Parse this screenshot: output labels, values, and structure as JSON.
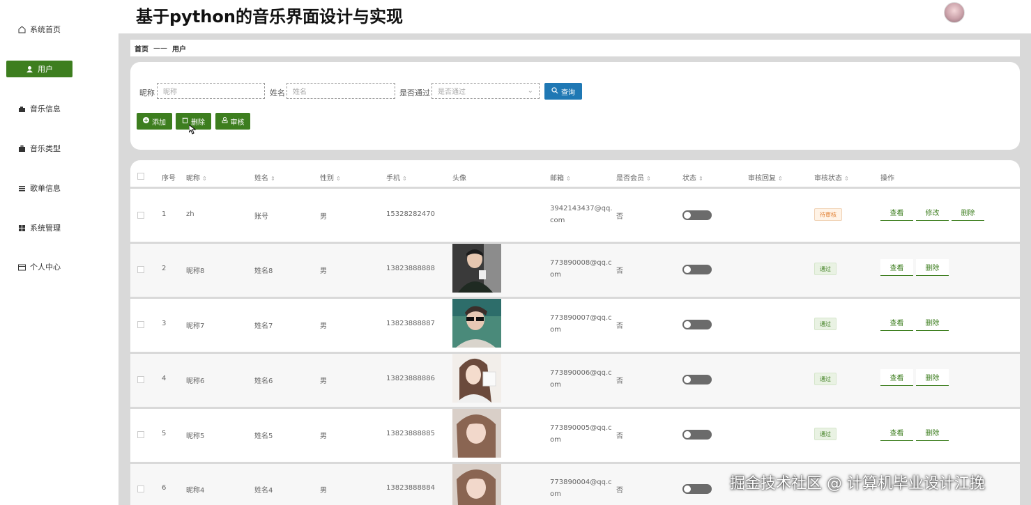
{
  "app": {
    "title": "基于python的音乐界面设计与实现"
  },
  "sidebar": {
    "items": [
      {
        "label": "系统首页",
        "icon": "home-icon"
      },
      {
        "label": "用户",
        "icon": "user-icon"
      },
      {
        "label": "音乐信息",
        "icon": "music-info-icon"
      },
      {
        "label": "音乐类型",
        "icon": "briefcase-icon"
      },
      {
        "label": "歌单信息",
        "icon": "list-icon"
      },
      {
        "label": "系统管理",
        "icon": "grid-icon"
      },
      {
        "label": "个人中心",
        "icon": "card-icon"
      }
    ],
    "active": "用户"
  },
  "breadcrumb": {
    "home": "首页",
    "separator": "——",
    "current": "用户"
  },
  "search": {
    "nickname_label": "昵称",
    "nickname_placeholder": "昵称",
    "name_label": "姓名",
    "name_placeholder": "姓名",
    "passed_label": "是否通过",
    "passed_placeholder": "是否通过",
    "query_label": "查询"
  },
  "actions": {
    "add": "添加",
    "delete": "删除",
    "review": "审核"
  },
  "table": {
    "headers": [
      "序号",
      "昵称",
      "姓名",
      "性别",
      "手机",
      "头像",
      "邮箱",
      "是否会员",
      "状态",
      "审核回复",
      "审核状态",
      "操作"
    ],
    "rows": [
      {
        "idx": "1",
        "nickname": "zh",
        "name": "账号",
        "gender": "男",
        "phone": "15328282470",
        "email": "3942143437@qq.com",
        "member": "否",
        "status_on": false,
        "review_status": "待审核",
        "ops": [
          "查看",
          "修改",
          "删除"
        ]
      },
      {
        "idx": "2",
        "nickname": "昵称8",
        "name": "姓名8",
        "gender": "男",
        "phone": "13823888888",
        "email": "773890008@qq.com",
        "member": "否",
        "status_on": false,
        "review_status": "通过",
        "ops": [
          "查看",
          "删除"
        ]
      },
      {
        "idx": "3",
        "nickname": "昵称7",
        "name": "姓名7",
        "gender": "男",
        "phone": "13823888887",
        "email": "773890007@qq.com",
        "member": "否",
        "status_on": false,
        "review_status": "通过",
        "ops": [
          "查看",
          "删除"
        ]
      },
      {
        "idx": "4",
        "nickname": "昵称6",
        "name": "姓名6",
        "gender": "男",
        "phone": "13823888886",
        "email": "773890006@qq.com",
        "member": "否",
        "status_on": false,
        "review_status": "通过",
        "ops": [
          "查看",
          "删除"
        ]
      },
      {
        "idx": "5",
        "nickname": "昵称5",
        "name": "姓名5",
        "gender": "男",
        "phone": "13823888885",
        "email": "773890005@qq.com",
        "member": "否",
        "status_on": false,
        "review_status": "通过",
        "ops": [
          "查看",
          "删除"
        ]
      },
      {
        "idx": "6",
        "nickname": "昵称4",
        "name": "姓名4",
        "gender": "男",
        "phone": "13823888884",
        "email": "773890004@qq.com",
        "member": "否",
        "status_on": false,
        "review_status": "",
        "ops": []
      }
    ]
  },
  "watermark": "掘金技术社区 @ 计算机毕业设计江挽",
  "colors": {
    "primary": "#3d7e1f",
    "query": "#1f78b4",
    "toggle": "#6b6b6b"
  }
}
